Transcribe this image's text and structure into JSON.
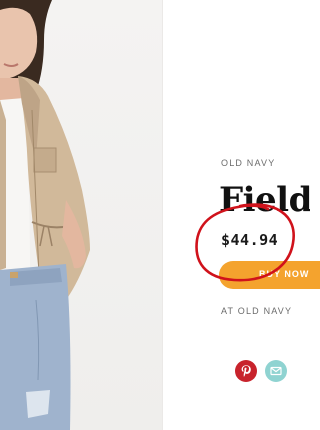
{
  "product": {
    "brand": "OLD NAVY",
    "title": "Field J",
    "price": "$44.94",
    "buy_label": "BUY NOW",
    "retailer": "AT OLD NAVY"
  },
  "share": {
    "pinterest_icon": "pinterest-icon",
    "email_icon": "email-icon"
  },
  "colors": {
    "buy_button": "#f4a32e",
    "annotation_circle": "#d0121b",
    "pinterest": "#c8232c",
    "email": "#8fd3d1"
  }
}
